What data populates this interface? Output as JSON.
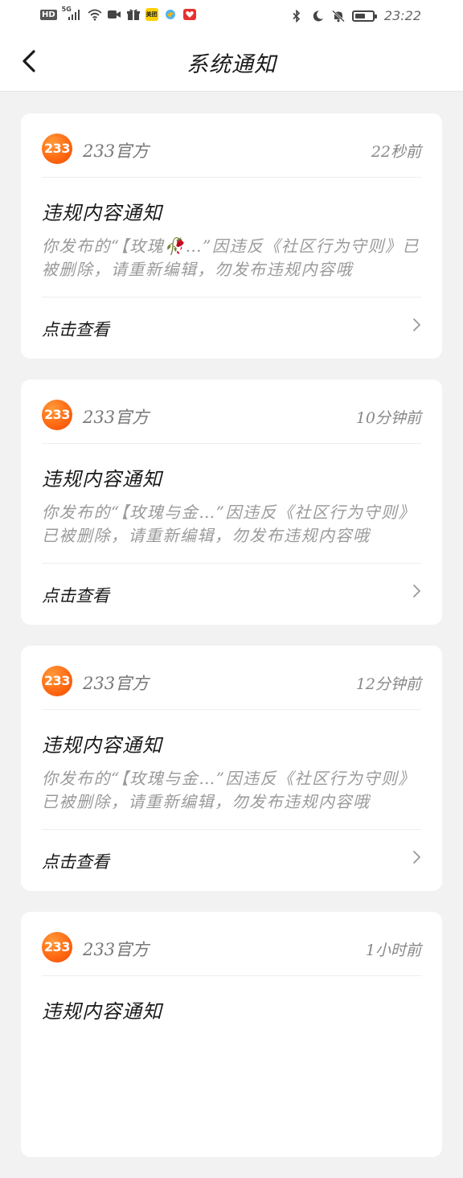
{
  "status_bar": {
    "network_badge": "HD",
    "signal_label": "5G",
    "meituan_label": "美团",
    "time": "23:22",
    "battery_level": 0.6
  },
  "header": {
    "title": "系统通知"
  },
  "notifications": [
    {
      "logo_text": "233",
      "sender": "233官方",
      "time": "22秒前",
      "title": "违规内容通知",
      "body": "你发布的“【玫瑰🥀…”因违反《社区行为守则》已被删除，请重新编辑，勿发布违规内容哦",
      "action": "点击查看"
    },
    {
      "logo_text": "233",
      "sender": "233官方",
      "time": "10分钟前",
      "title": "违规内容通知",
      "body": "你发布的“【玫瑰与金…”因违反《社区行为守则》已被删除，请重新编辑，勿发布违规内容哦",
      "action": "点击查看"
    },
    {
      "logo_text": "233",
      "sender": "233官方",
      "time": "12分钟前",
      "title": "违规内容通知",
      "body": "你发布的“【玫瑰与金…”因违反《社区行为守则》已被删除，请重新编辑，勿发布违规内容哦",
      "action": "点击查看"
    },
    {
      "logo_text": "233",
      "sender": "233官方",
      "time": "1小时前",
      "title": "违规内容通知"
    }
  ]
}
